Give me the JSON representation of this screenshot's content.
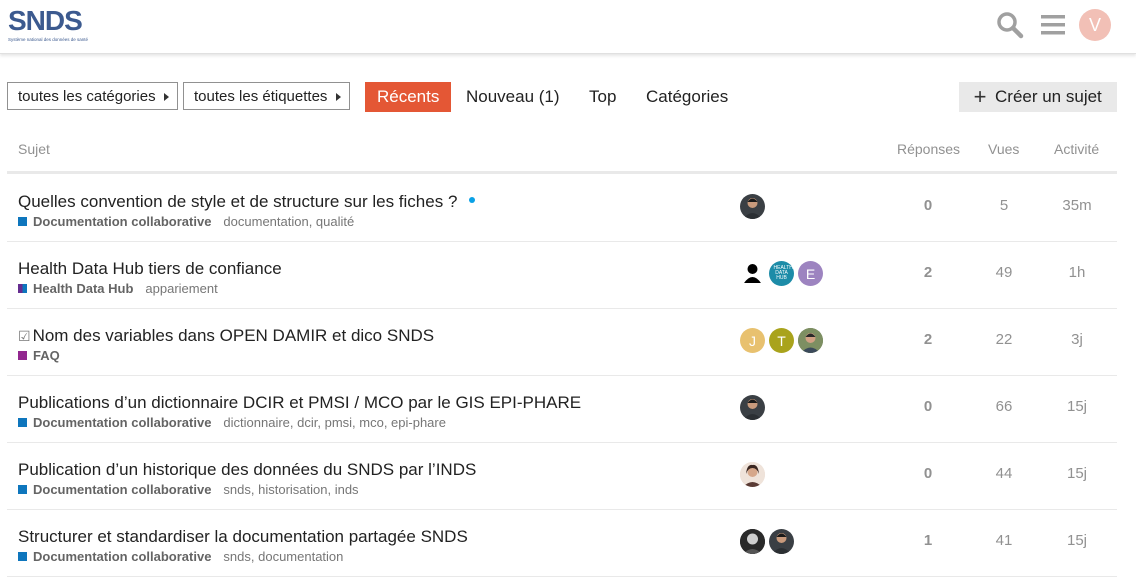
{
  "header": {
    "logo_text": "SNDS",
    "logo_subtitle": "Système national des données de santé",
    "user_initial": "V",
    "colors": {
      "avatar": "#f2c0b6",
      "logo": "#3c5a8f"
    }
  },
  "nav": {
    "categories_dropdown": "toutes les catégories",
    "tags_dropdown": "toutes les étiquettes",
    "tabs": [
      {
        "label": "Récents",
        "active": true
      },
      {
        "label": "Nouveau (1)",
        "active": false
      },
      {
        "label": "Top",
        "active": false
      },
      {
        "label": "Catégories",
        "active": false
      }
    ],
    "create_label": "Créer un sujet",
    "accent": "#e45735"
  },
  "columns": {
    "topic": "Sujet",
    "replies": "Réponses",
    "views": "Vues",
    "activity": "Activité"
  },
  "topics": [
    {
      "title": "Quelles convention de style et de structure sur les fiches ?",
      "category": "Documentation collaborative",
      "category_color": "#0e76bd",
      "tags": "documentation, qualité",
      "unread_dot": true,
      "replies": "0",
      "views": "5",
      "activity": "35m"
    },
    {
      "title": "Health Data Hub tiers de confiance",
      "category": "Health Data Hub",
      "category_color": "#652d90",
      "tags": "appariement",
      "replies": "2",
      "views": "49",
      "activity": "1h"
    },
    {
      "title": "Nom des variables dans OPEN DAMIR et dico SNDS",
      "solved_icon": "checkbox-icon",
      "category": "FAQ",
      "category_color": "#92278f",
      "tags": "",
      "replies": "2",
      "views": "22",
      "activity": "3j"
    },
    {
      "title": "Publications d’un dictionnaire DCIR et PMSI / MCO par le GIS EPI-PHARE",
      "category": "Documentation collaborative",
      "category_color": "#0e76bd",
      "tags": "dictionnaire, dcir, pmsi, mco, epi-phare",
      "replies": "0",
      "views": "66",
      "activity": "15j"
    },
    {
      "title": "Publication d’un historique des données du SNDS par l’INDS",
      "category": "Documentation collaborative",
      "category_color": "#0e76bd",
      "tags": "snds, historisation, inds",
      "replies": "0",
      "views": "44",
      "activity": "15j"
    },
    {
      "title": "Structurer et standardiser la documentation partagée SNDS",
      "category": "Documentation collaborative",
      "category_color": "#0e76bd",
      "tags": "snds, documentation",
      "replies": "1",
      "views": "41",
      "activity": "15j"
    }
  ],
  "avatars": {
    "row2_e": "E",
    "row2_hdh": "HEALTH DATA HUB",
    "row3_j": "J",
    "row3_t": "T"
  }
}
